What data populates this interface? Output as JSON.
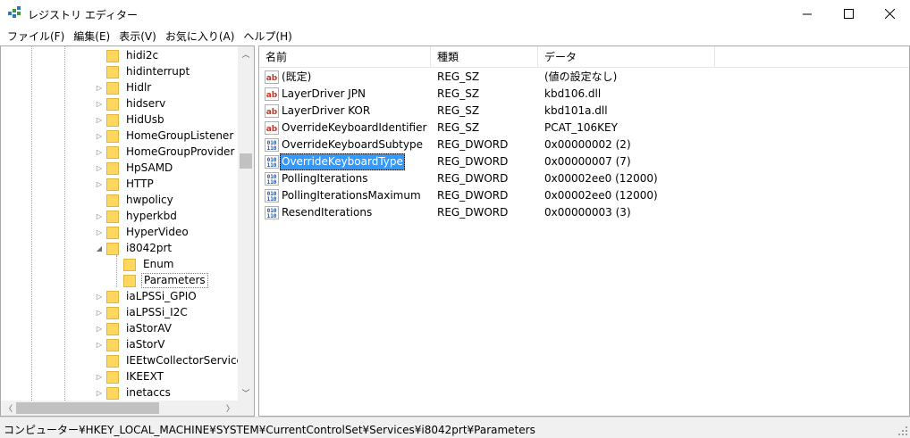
{
  "window": {
    "title": "レジストリ エディター",
    "controls": {
      "minimize_icon": "minimize-icon",
      "maximize_icon": "maximize-icon",
      "close_icon": "close-icon"
    }
  },
  "menu": [
    {
      "label": "ファイル(F)"
    },
    {
      "label": "編集(E)"
    },
    {
      "label": "表示(V)"
    },
    {
      "label": "お気に入り(A)"
    },
    {
      "label": "ヘルプ(H)"
    }
  ],
  "tree": {
    "items": [
      {
        "label": "hidi2c",
        "expander": ""
      },
      {
        "label": "hidinterrupt",
        "expander": ""
      },
      {
        "label": "Hidlr",
        "expander": "▷"
      },
      {
        "label": "hidserv",
        "expander": "▷"
      },
      {
        "label": "HidUsb",
        "expander": "▷"
      },
      {
        "label": "HomeGroupListener",
        "expander": "▷"
      },
      {
        "label": "HomeGroupProvider",
        "expander": "▷"
      },
      {
        "label": "HpSAMD",
        "expander": "▷"
      },
      {
        "label": "HTTP",
        "expander": "▷"
      },
      {
        "label": "hwpolicy",
        "expander": ""
      },
      {
        "label": "hyperkbd",
        "expander": "▷"
      },
      {
        "label": "HyperVideo",
        "expander": "▷"
      },
      {
        "label": "i8042prt",
        "expander": "◢"
      },
      {
        "label": "Enum",
        "expander": ""
      },
      {
        "label": "Parameters",
        "expander": ""
      },
      {
        "label": "iaLPSSi_GPIO",
        "expander": "▷"
      },
      {
        "label": "iaLPSSi_I2C",
        "expander": "▷"
      },
      {
        "label": "iaStorAV",
        "expander": "▷"
      },
      {
        "label": "iaStorV",
        "expander": "▷"
      },
      {
        "label": "IEEtwCollectorService",
        "expander": ""
      },
      {
        "label": "IKEEXT",
        "expander": "▷"
      },
      {
        "label": "inetaccs",
        "expander": "▷"
      }
    ],
    "selected": "Parameters"
  },
  "list": {
    "columns": {
      "name": "名前",
      "type": "種類",
      "data": "データ"
    },
    "rows": [
      {
        "name": "(既定)",
        "type": "REG_SZ",
        "data": "(値の設定なし)",
        "icon": "string-value-icon"
      },
      {
        "name": "LayerDriver JPN",
        "type": "REG_SZ",
        "data": "kbd106.dll",
        "icon": "string-value-icon"
      },
      {
        "name": "LayerDriver KOR",
        "type": "REG_SZ",
        "data": "kbd101a.dll",
        "icon": "string-value-icon"
      },
      {
        "name": "OverrideKeyboardIdentifier",
        "type": "REG_SZ",
        "data": "PCAT_106KEY",
        "icon": "string-value-icon"
      },
      {
        "name": "OverrideKeyboardSubtype",
        "type": "REG_DWORD",
        "data": "0x00000002 (2)",
        "icon": "binary-value-icon"
      },
      {
        "name": "OverrideKeyboardType",
        "type": "REG_DWORD",
        "data": "0x00000007 (7)",
        "icon": "binary-value-icon"
      },
      {
        "name": "PollingIterations",
        "type": "REG_DWORD",
        "data": "0x00002ee0 (12000)",
        "icon": "binary-value-icon"
      },
      {
        "name": "PollingIterationsMaximum",
        "type": "REG_DWORD",
        "data": "0x00002ee0 (12000)",
        "icon": "binary-value-icon"
      },
      {
        "name": "ResendIterations",
        "type": "REG_DWORD",
        "data": "0x00000003 (3)",
        "icon": "binary-value-icon"
      }
    ],
    "selected": "OverrideKeyboardType"
  },
  "status": {
    "path": "コンピューター¥HKEY_LOCAL_MACHINE¥SYSTEM¥CurrentControlSet¥Services¥i8042prt¥Parameters"
  },
  "colors": {
    "selection": "#3399ff",
    "folder": "#ffd75e",
    "border": "#a9a9a9"
  }
}
